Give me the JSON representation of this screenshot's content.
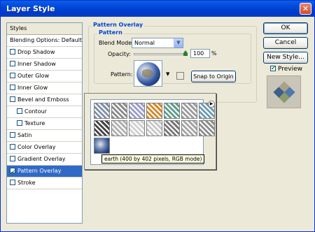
{
  "window": {
    "title": "Layer Style",
    "close_glyph": "✕"
  },
  "styles_list": {
    "header": "Styles",
    "items": [
      {
        "label": "Blending Options: Default",
        "checkbox": false,
        "sub": false,
        "selected": false
      },
      {
        "label": "Drop Shadow",
        "checkbox": true,
        "checked": false,
        "sub": false,
        "selected": false
      },
      {
        "label": "Inner Shadow",
        "checkbox": true,
        "checked": false,
        "sub": false,
        "selected": false
      },
      {
        "label": "Outer Glow",
        "checkbox": true,
        "checked": false,
        "sub": false,
        "selected": false
      },
      {
        "label": "Inner Glow",
        "checkbox": true,
        "checked": false,
        "sub": false,
        "selected": false
      },
      {
        "label": "Bevel and Emboss",
        "checkbox": true,
        "checked": false,
        "sub": false,
        "selected": false
      },
      {
        "label": "Contour",
        "checkbox": true,
        "checked": false,
        "sub": true,
        "selected": false
      },
      {
        "label": "Texture",
        "checkbox": true,
        "checked": false,
        "sub": true,
        "selected": false
      },
      {
        "label": "Satin",
        "checkbox": true,
        "checked": false,
        "sub": false,
        "selected": false
      },
      {
        "label": "Color Overlay",
        "checkbox": true,
        "checked": false,
        "sub": false,
        "selected": false
      },
      {
        "label": "Gradient Overlay",
        "checkbox": true,
        "checked": false,
        "sub": false,
        "selected": false
      },
      {
        "label": "Pattern Overlay",
        "checkbox": true,
        "checked": true,
        "sub": false,
        "selected": true
      },
      {
        "label": "Stroke",
        "checkbox": true,
        "checked": false,
        "sub": false,
        "selected": false
      }
    ]
  },
  "pattern_overlay": {
    "group_title": "Pattern Overlay",
    "subgroup_title": "Pattern",
    "blend_mode_label": "Blend Mode:",
    "blend_mode_value": "Normal",
    "opacity_label": "Opacity:",
    "opacity_value": "100",
    "opacity_unit": "%",
    "opacity_fraction": 1.0,
    "pattern_label": "Pattern:",
    "snap_button": "Snap to Origin"
  },
  "buttons": {
    "ok": "OK",
    "cancel": "Cancel",
    "new_style": "New Style...",
    "preview_label": "Preview",
    "preview_checked": true
  },
  "pattern_picker": {
    "tooltip": "earth (400 by 402 pixels, RGB mode)",
    "menu_arrow_glyph": "▶",
    "swatch_colors": [
      "#7f8fa8",
      "#8a8a8a",
      "#9a9ec8",
      "#d4892a",
      "#5f9c8a",
      "#9c9c9c",
      "#6e9ab0",
      "#444444",
      "#b0b0b0",
      "#d0d0d0",
      "#c8c8c8",
      "#777777",
      "#a5a5a5",
      "#8d8d8d",
      "#2f5a96"
    ]
  }
}
